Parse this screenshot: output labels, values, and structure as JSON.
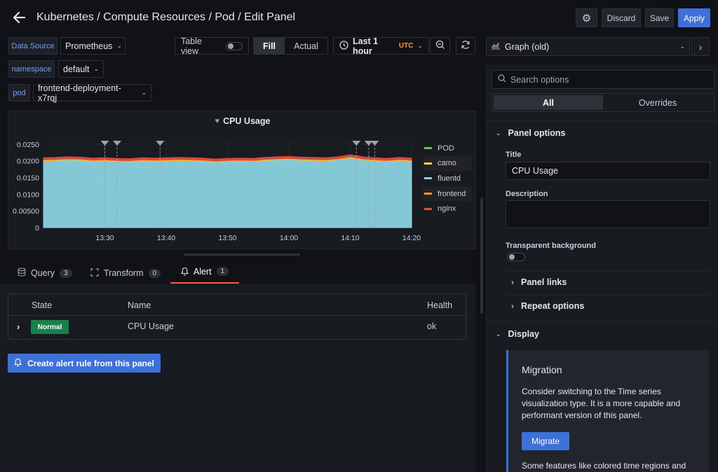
{
  "header": {
    "title": "Kubernetes / Compute Resources / Pod / Edit Panel",
    "discard_label": "Discard",
    "save_label": "Save",
    "apply_label": "Apply"
  },
  "variables": [
    {
      "label": "Data Source",
      "value": "Prometheus"
    },
    {
      "label": "namespace",
      "value": "default"
    },
    {
      "label": "pod",
      "value": "frontend-deployment-x7rqj"
    }
  ],
  "toolbar": {
    "table_view_label": "Table view",
    "fill_label": "Fill",
    "actual_label": "Actual",
    "time_range": "Last 1 hour",
    "timezone": "UTC"
  },
  "panel": {
    "title": "CPU Usage"
  },
  "chart_data": {
    "type": "area",
    "title": "CPU Usage",
    "x": [
      "13:20",
      "13:22",
      "13:24",
      "13:26",
      "13:28",
      "13:30",
      "13:32",
      "13:34",
      "13:36",
      "13:38",
      "13:40",
      "13:42",
      "13:44",
      "13:46",
      "13:48",
      "13:50",
      "13:52",
      "13:54",
      "13:56",
      "13:58",
      "14:00",
      "14:02",
      "14:04",
      "14:06",
      "14:08",
      "14:10",
      "14:12",
      "14:14",
      "14:16",
      "14:18",
      "14:20"
    ],
    "x_ticks": [
      "13:30",
      "13:40",
      "13:50",
      "14:00",
      "14:10",
      "14:20"
    ],
    "y_ticks": [
      "0",
      "0.00500",
      "0.0100",
      "0.0150",
      "0.0200",
      "0.0250"
    ],
    "ylim": [
      0,
      0.026
    ],
    "stacked": true,
    "series": [
      {
        "name": "POD",
        "color": "#73bf69",
        "values": [
          1e-05,
          1e-05,
          1e-05,
          1e-05,
          1e-05,
          1e-05,
          1e-05,
          1e-05,
          1e-05,
          1e-05,
          1e-05,
          1e-05,
          1e-05,
          1e-05,
          1e-05,
          1e-05,
          1e-05,
          1e-05,
          1e-05,
          1e-05,
          1e-05,
          1e-05,
          1e-05,
          1e-05,
          1e-05,
          1e-05,
          1e-05,
          1e-05,
          1e-05,
          1e-05,
          1e-05
        ]
      },
      {
        "name": "camo",
        "color": "#fade2a",
        "values": [
          0.0001,
          0.0001,
          0.0001,
          0.0001,
          0.0001,
          0.0001,
          0.0001,
          0.0001,
          0.0001,
          0.0001,
          0.0001,
          0.0001,
          0.0001,
          0.0001,
          0.0001,
          0.0001,
          0.0001,
          0.0001,
          0.0001,
          0.0001,
          0.0001,
          0.0001,
          0.0001,
          0.0001,
          0.0001,
          0.0001,
          0.0001,
          0.0001,
          0.0001,
          0.0001,
          0.0001
        ]
      },
      {
        "name": "fluentd",
        "color": "#8ad2e0",
        "values": [
          0.02,
          0.0201,
          0.0203,
          0.0202,
          0.0199,
          0.02,
          0.0198,
          0.0197,
          0.02,
          0.0199,
          0.02,
          0.0201,
          0.02,
          0.0199,
          0.0196,
          0.0198,
          0.0199,
          0.0198,
          0.0201,
          0.0203,
          0.0204,
          0.0202,
          0.0201,
          0.02,
          0.0203,
          0.0209,
          0.0203,
          0.02,
          0.0198,
          0.0201,
          0.0199
        ]
      },
      {
        "name": "frontend",
        "color": "#ff9830",
        "values": [
          0.0002,
          0.0002,
          0.0002,
          0.0002,
          0.0002,
          0.0002,
          0.0002,
          0.0002,
          0.0002,
          0.0002,
          0.0002,
          0.0002,
          0.0002,
          0.0002,
          0.0002,
          0.0002,
          0.0002,
          0.0002,
          0.0002,
          0.0002,
          0.0002,
          0.0002,
          0.0002,
          0.0002,
          0.0002,
          0.0002,
          0.0002,
          0.0002,
          0.0002,
          0.0002,
          0.0002
        ]
      },
      {
        "name": "nginx",
        "color": "#e0503f",
        "values": [
          0.0006,
          0.0006,
          0.0006,
          0.0006,
          0.0006,
          0.0006,
          0.0006,
          0.0006,
          0.0006,
          0.0006,
          0.0006,
          0.0006,
          0.0006,
          0.0006,
          0.0006,
          0.0006,
          0.0006,
          0.0006,
          0.0006,
          0.0006,
          0.0006,
          0.0006,
          0.0006,
          0.0006,
          0.0006,
          0.0006,
          0.0006,
          0.0006,
          0.0006,
          0.0006,
          0.0006
        ]
      }
    ],
    "annotations_x": [
      "13:30",
      "13:32",
      "13:39",
      "14:11",
      "14:13",
      "14:14"
    ]
  },
  "tabs": [
    {
      "label": "Query",
      "count": "3"
    },
    {
      "label": "Transform",
      "count": "0"
    },
    {
      "label": "Alert",
      "count": "1"
    }
  ],
  "alert_table": {
    "headers": {
      "state": "State",
      "name": "Name",
      "health": "Health"
    },
    "rows": [
      {
        "state": "Normal",
        "name": "CPU Usage",
        "health": "ok"
      }
    ]
  },
  "create_alert_label": "Create alert rule from this panel",
  "options": {
    "visualization": "Graph (old)",
    "search_placeholder": "Search options",
    "all_label": "All",
    "overrides_label": "Overrides",
    "panel_options_label": "Panel options",
    "title_label": "Title",
    "title_value": "CPU Usage",
    "description_label": "Description",
    "transparent_label": "Transparent background",
    "panel_links_label": "Panel links",
    "repeat_options_label": "Repeat options",
    "display_label": "Display",
    "migration_title": "Migration",
    "migration_text": "Consider switching to the Time series visualization type. It is a more capable and performant version of this panel.",
    "migrate_label": "Migrate",
    "migration_more": "Some features like colored time regions and"
  }
}
